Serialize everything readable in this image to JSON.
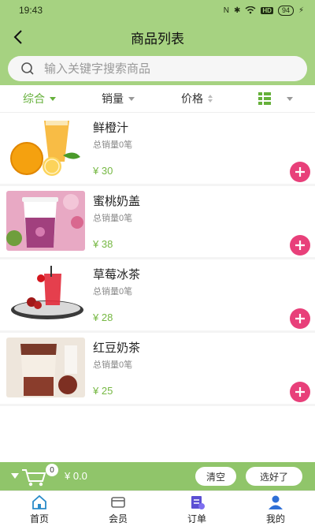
{
  "status_bar": {
    "time": "19:43",
    "network_badge": "HD",
    "battery": "94"
  },
  "header": {
    "title": "商品列表"
  },
  "search": {
    "placeholder": "输入关键字搜索商品"
  },
  "sort": {
    "items": [
      {
        "label": "综合"
      },
      {
        "label": "销量"
      },
      {
        "label": "价格"
      }
    ]
  },
  "products": [
    {
      "name": "鲜橙汁",
      "sales": "总销量0笔",
      "price": "¥ 30"
    },
    {
      "name": "蜜桃奶盖",
      "sales": "总销量0笔",
      "price": "¥ 38"
    },
    {
      "name": "草莓冰茶",
      "sales": "总销量0笔",
      "price": "¥ 28"
    },
    {
      "name": "红豆奶茶",
      "sales": "总销量0笔",
      "price": "¥ 25"
    }
  ],
  "cart": {
    "count": "0",
    "total": "¥ 0.0",
    "clear_label": "清空",
    "done_label": "选好了"
  },
  "tabs": [
    {
      "label": "首页"
    },
    {
      "label": "会员"
    },
    {
      "label": "订单"
    },
    {
      "label": "我的"
    }
  ],
  "colors": {
    "primary": "#a6d281",
    "accent_green": "#65b03a",
    "add_pink": "#e8407a"
  },
  "icons": {
    "back": "chevron-left-icon",
    "search": "search-icon",
    "add": "plus-icon",
    "cart": "cart-icon",
    "layout": "grid-list-icon"
  }
}
